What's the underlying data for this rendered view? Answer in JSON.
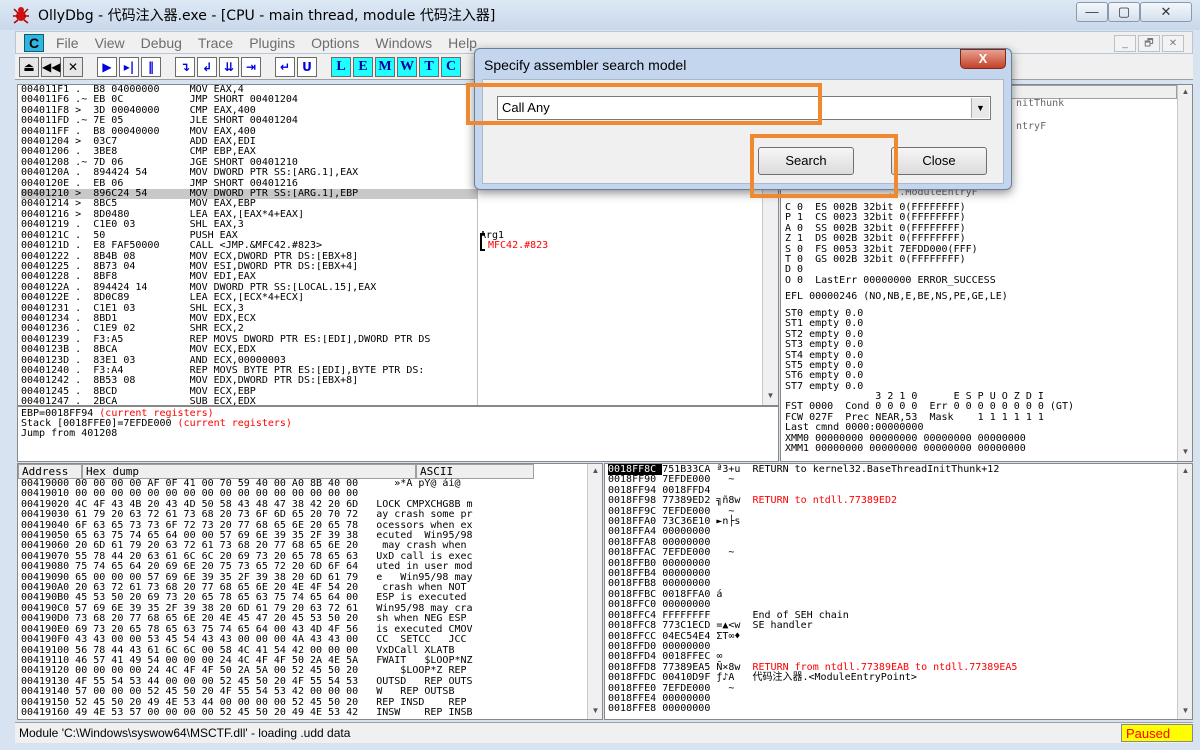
{
  "window": {
    "title": "OllyDbg - 代码注入器.exe - [CPU - main thread, module 代码注入器]",
    "min": "—",
    "max": "▢",
    "close": "✕"
  },
  "menu": {
    "icon": "C",
    "items": [
      "File",
      "View",
      "Debug",
      "Trace",
      "Plugins",
      "Options",
      "Windows",
      "Help"
    ],
    "mdi": [
      "_",
      "🗗",
      "✕"
    ]
  },
  "toolbar": {
    "buttons": [
      "⏏",
      "◀◀",
      "✕",
      "▶",
      "▸|",
      "‖",
      "↴",
      "↲",
      "⇊",
      "⇥",
      "↵",
      "U",
      "L",
      "E",
      "M",
      "W",
      "T",
      "C"
    ]
  },
  "disasm": {
    "rows": [
      [
        "004011F1",
        ".",
        "B8 04000000",
        "MOV EAX,4"
      ],
      [
        "004011F6",
        ".~",
        "EB 0C",
        "JMP SHORT 00401204"
      ],
      [
        "004011F8",
        ">",
        "3D 00040000",
        "CMP EAX,400"
      ],
      [
        "004011FD",
        ".~",
        "7E 05",
        "JLE SHORT 00401204"
      ],
      [
        "004011FF",
        ".",
        "B8 00040000",
        "MOV EAX,400"
      ],
      [
        "00401204",
        ">",
        "03C7",
        "ADD EAX,EDI"
      ],
      [
        "00401206",
        ".",
        "3BE8",
        "CMP EBP,EAX"
      ],
      [
        "00401208",
        ".~",
        "7D 06",
        "JGE SHORT 00401210"
      ],
      [
        "0040120A",
        ".",
        "894424 54",
        "MOV DWORD PTR SS:[ARG.1],EAX"
      ],
      [
        "0040120E",
        ".",
        "EB 06",
        "JMP SHORT 00401216"
      ],
      [
        "00401210",
        ">",
        "896C24 54",
        "MOV DWORD PTR SS:[ARG.1],EBP"
      ],
      [
        "00401214",
        ">",
        "8BC5",
        "MOV EAX,EBP"
      ],
      [
        "00401216",
        ">",
        "8D0480",
        "LEA EAX,[EAX*4+EAX]"
      ],
      [
        "00401219",
        ".",
        "C1E0 03",
        "SHL EAX,3"
      ],
      [
        "0040121C",
        ".",
        "50",
        "PUSH EAX"
      ],
      [
        "0040121D",
        ".",
        "E8 FAF50000",
        "CALL <JMP.&MFC42.#823>"
      ],
      [
        "00401222",
        ".",
        "8B4B 08",
        "MOV ECX,DWORD PTR DS:[EBX+8]"
      ],
      [
        "00401225",
        ".",
        "8B73 04",
        "MOV ESI,DWORD PTR DS:[EBX+4]"
      ],
      [
        "00401228",
        ".",
        "8BF8",
        "MOV EDI,EAX"
      ],
      [
        "0040122A",
        ".",
        "894424 14",
        "MOV DWORD PTR SS:[LOCAL.15],EAX"
      ],
      [
        "0040122E",
        ".",
        "8D0C89",
        "LEA ECX,[ECX*4+ECX]"
      ],
      [
        "00401231",
        ".",
        "C1E1 03",
        "SHL ECX,3"
      ],
      [
        "00401234",
        ".",
        "8BD1",
        "MOV EDX,ECX"
      ],
      [
        "00401236",
        ".",
        "C1E9 02",
        "SHR ECX,2"
      ],
      [
        "00401239",
        ".",
        "F3:A5",
        "REP MOVS DWORD PTR ES:[EDI],DWORD PTR DS"
      ],
      [
        "0040123B",
        ".",
        "8BCA",
        "MOV ECX,EDX"
      ],
      [
        "0040123D",
        ".",
        "83E1 03",
        "AND ECX,00000003"
      ],
      [
        "00401240",
        ".",
        "F3:A4",
        "REP MOVS BYTE PTR ES:[EDI],BYTE PTR DS:"
      ],
      [
        "00401242",
        ".",
        "8B53 08",
        "MOV EDX,DWORD PTR DS:[EBX+8]"
      ],
      [
        "00401245",
        ".",
        "8BCD",
        "MOV ECX,EBP"
      ],
      [
        "00401247",
        ".",
        "2BCA",
        "SUB ECX,EDX"
      ]
    ],
    "selected": 10,
    "comment_arg": "Arg1",
    "comment_fn": "MFC42.#823"
  },
  "info": {
    "line1": "EBP=0018FF94",
    "line1b": "(current registers)",
    "line2": "Stack [0018FFE0]=7EFDE000",
    "line2b": "(current registers)",
    "line3": "Jump from 401208"
  },
  "registers": {
    "top": [
      "nitThunk",
      "ntryF",
      "",
      "",
      "",
      "",
      "",
      "",
      "",
      "",
      "",
      "ModuleEntryF"
    ],
    "flags": [
      "C 0  ES 002B 32bit 0(FFFFFFFF)",
      "P 1  CS 0023 32bit 0(FFFFFFFF)",
      "A 0  SS 002B 32bit 0(FFFFFFFF)",
      "Z 1  DS 002B 32bit 0(FFFFFFFF)",
      "S 0  FS 0053 32bit 7EFDD000(FFF)",
      "T 0  GS 002B 32bit 0(FFFFFFFF)",
      "D 0",
      "O 0  LastErr 00000000 ERROR_SUCCESS"
    ],
    "efl": "EFL 00000246 (NO,NB,E,BE,NS,PE,GE,LE)",
    "st": [
      "ST0 empty 0.0",
      "ST1 empty 0.0",
      "ST2 empty 0.0",
      "ST3 empty 0.0",
      "ST4 empty 0.0",
      "ST5 empty 0.0",
      "ST6 empty 0.0",
      "ST7 empty 0.0"
    ],
    "fpu": [
      "               3 2 1 0      E S P U O Z D I",
      "FST 0000  Cond 0 0 0 0  Err 0 0 0 0 0 0 0 0 (GT)",
      "FCW 027F  Prec NEAR,53  Mask    1 1 1 1 1 1",
      "Last cmnd 0000:00000000",
      "",
      "XMM0 00000000 00000000 00000000 00000000",
      "XMM1 00000000 00000000 00000000 00000000"
    ]
  },
  "dump": {
    "headers": [
      "Address",
      "Hex dump",
      "ASCII"
    ],
    "rows": [
      [
        "00419000",
        "00 00 00 00 AF 0F 41 00 70 59 40 00 A0 8B 40 00",
        "   »*A pY@ ái@"
      ],
      [
        "00419010",
        "00 00 00 00 00 00 00 00 00 00 00 00 00 00 00 00",
        ""
      ],
      [
        "00419020",
        "4C 4F 43 4B 20 43 4D 50 58 43 48 47 38 42 20 6D",
        "LOCK CMPXCHG8B m"
      ],
      [
        "00419030",
        "61 79 20 63 72 61 73 68 20 73 6F 6D 65 20 70 72",
        "ay crash some pr"
      ],
      [
        "00419040",
        "6F 63 65 73 73 6F 72 73 20 77 68 65 6E 20 65 78",
        "ocessors when ex"
      ],
      [
        "00419050",
        "65 63 75 74 65 64 00 00 57 69 6E 39 35 2F 39 38",
        "ecuted  Win95/98"
      ],
      [
        "00419060",
        "20 6D 61 79 20 63 72 61 73 68 20 77 68 65 6E 20",
        " may crash when "
      ],
      [
        "00419070",
        "55 78 44 20 63 61 6C 6C 20 69 73 20 65 78 65 63",
        "UxD call is exec"
      ],
      [
        "00419080",
        "75 74 65 64 20 69 6E 20 75 73 65 72 20 6D 6F 64",
        "uted in user mod"
      ],
      [
        "00419090",
        "65 00 00 00 57 69 6E 39 35 2F 39 38 20 6D 61 79",
        "e   Win95/98 may"
      ],
      [
        "004190A0",
        "20 63 72 61 73 68 20 77 68 65 6E 20 4E 4F 54 20",
        " crash when NOT "
      ],
      [
        "004190B0",
        "45 53 50 20 69 73 20 65 78 65 63 75 74 65 64 00",
        "ESP is executed "
      ],
      [
        "004190C0",
        "57 69 6E 39 35 2F 39 38 20 6D 61 79 20 63 72 61",
        "Win95/98 may cra"
      ],
      [
        "004190D0",
        "73 68 20 77 68 65 6E 20 4E 45 47 20 45 53 50 20",
        "sh when NEG ESP "
      ],
      [
        "004190E0",
        "69 73 20 65 78 65 63 75 74 65 64 00 43 4D 4F 56",
        "is executed CMOV"
      ],
      [
        "004190F0",
        "43 43 00 00 53 45 54 43 43 00 00 00 4A 43 43 00",
        "CC  SETCC   JCC "
      ],
      [
        "00419100",
        "56 78 44 43 61 6C 6C 00 58 4C 41 54 42 00 00 00",
        "VxDCall XLATB   "
      ],
      [
        "00419110",
        "46 57 41 49 54 00 00 00 24 4C 4F 4F 50 2A 4E 5A",
        "FWAIT   $LOOP*NZ"
      ],
      [
        "00419120",
        "00 00 00 00 24 4C 4F 4F 50 2A 5A 00 52 45 50 20",
        "    $LOOP*Z REP "
      ],
      [
        "00419130",
        "4F 55 54 53 44 00 00 00 52 45 50 20 4F 55 54 53",
        "OUTSD   REP OUTS"
      ],
      [
        "00419140",
        "57 00 00 00 52 45 50 20 4F 55 54 53 42 00 00 00",
        "W   REP OUTSB   "
      ],
      [
        "00419150",
        "52 45 50 20 49 4E 53 44 00 00 00 00 52 45 50 20",
        "REP INSD    REP "
      ],
      [
        "00419160",
        "49 4E 53 57 00 00 00 00 52 45 50 20 49 4E 53 42",
        "INSW    REP INSB"
      ]
    ]
  },
  "stack": {
    "rows": [
      [
        "0018FF8C",
        "751B33CA",
        "ª3+u",
        "RETURN to kernel32.BaseThreadInitThunk+12"
      ],
      [
        "0018FF90",
        "7EFDE000",
        "  ~",
        ""
      ],
      [
        "0018FF94",
        "0018FFD4",
        "  ",
        ""
      ],
      [
        "0018FF98",
        "77389ED2",
        "╗ñ8w",
        "RETURN to ntdll.77389ED2"
      ],
      [
        "0018FF9C",
        "7EFDE000",
        "  ~",
        ""
      ],
      [
        "0018FFA0",
        "73C36E10",
        "►n├s",
        ""
      ],
      [
        "0018FFA4",
        "00000000",
        "",
        ""
      ],
      [
        "0018FFA8",
        "00000000",
        "",
        ""
      ],
      [
        "0018FFAC",
        "7EFDE000",
        "  ~",
        ""
      ],
      [
        "0018FFB0",
        "00000000",
        "",
        ""
      ],
      [
        "0018FFB4",
        "00000000",
        "",
        ""
      ],
      [
        "0018FFB8",
        "00000000",
        "",
        ""
      ],
      [
        "0018FFBC",
        "0018FFA0",
        "á ",
        ""
      ],
      [
        "0018FFC0",
        "00000000",
        "",
        ""
      ],
      [
        "0018FFC4",
        "FFFFFFFF",
        "",
        "End of SEH chain"
      ],
      [
        "0018FFC8",
        "773C1ECD",
        "=▲<w",
        "SE handler"
      ],
      [
        "0018FFCC",
        "04EC54E4",
        "ΣT∞♦",
        ""
      ],
      [
        "0018FFD0",
        "00000000",
        "",
        ""
      ],
      [
        "0018FFD4",
        "0018FFEC",
        "∞ ",
        ""
      ],
      [
        "0018FFD8",
        "77389EA5",
        "Ñ×8w",
        "RETURN from ntdll.77389EAB to ntdll.77389EA5"
      ],
      [
        "0018FFDC",
        "00410D9F",
        "ƒ♪A ",
        "代码注入器.<ModuleEntryPoint>"
      ],
      [
        "0018FFE0",
        "7EFDE000",
        "  ~",
        ""
      ],
      [
        "0018FFE4",
        "00000000",
        "",
        ""
      ],
      [
        "0018FFE8",
        "00000000",
        "",
        ""
      ]
    ]
  },
  "status": {
    "text": "Module 'C:\\Windows\\syswow64\\MSCTF.dll' - loading .udd data",
    "state": "Paused"
  },
  "dialog": {
    "title": "Specify assembler search model",
    "close": "X",
    "combo_value": "Call Any",
    "search": "Search",
    "close_btn": "Close"
  },
  "colors": {
    "highlight": "#f08830",
    "paused_bg": "#ffff00",
    "paused_fg": "#ff0000",
    "return_text": "#ff0000"
  }
}
